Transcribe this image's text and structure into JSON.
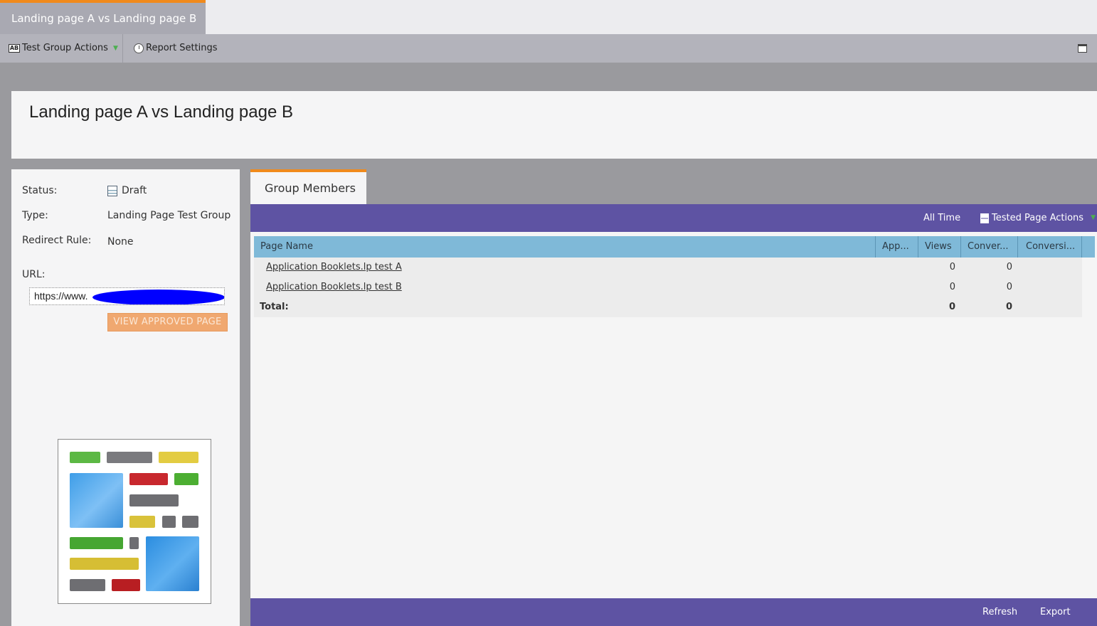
{
  "window_tab": {
    "title": "Landing page A vs Landing page B"
  },
  "toolbar": {
    "test_group_actions": "Test Group Actions",
    "report_settings": "Report Settings"
  },
  "page": {
    "title": "Landing page A vs Landing page B"
  },
  "info": {
    "status_label": "Status:",
    "status_value": "Draft",
    "type_label": "Type:",
    "type_value": "Landing Page Test Group",
    "redirect_label": "Redirect Rule:",
    "redirect_value": "None",
    "url_label": "URL:",
    "url_value": "https://www.",
    "view_button": "VIEW APPROVED PAGE"
  },
  "members": {
    "tab_label": "Group Members",
    "time_range": "All Time",
    "tested_page_actions": "Tested Page Actions",
    "columns": [
      "Page Name",
      "App...",
      "Views",
      "Conver...",
      "Conversi..."
    ],
    "rows": [
      {
        "name": "Application Booklets.lp test A",
        "views": "0",
        "conversions": "0"
      },
      {
        "name": "Application Booklets.lp test B",
        "views": "0",
        "conversions": "0"
      }
    ],
    "total": {
      "label": "Total:",
      "views": "0",
      "conversions": "0"
    },
    "refresh": "Refresh",
    "export": "Export"
  }
}
